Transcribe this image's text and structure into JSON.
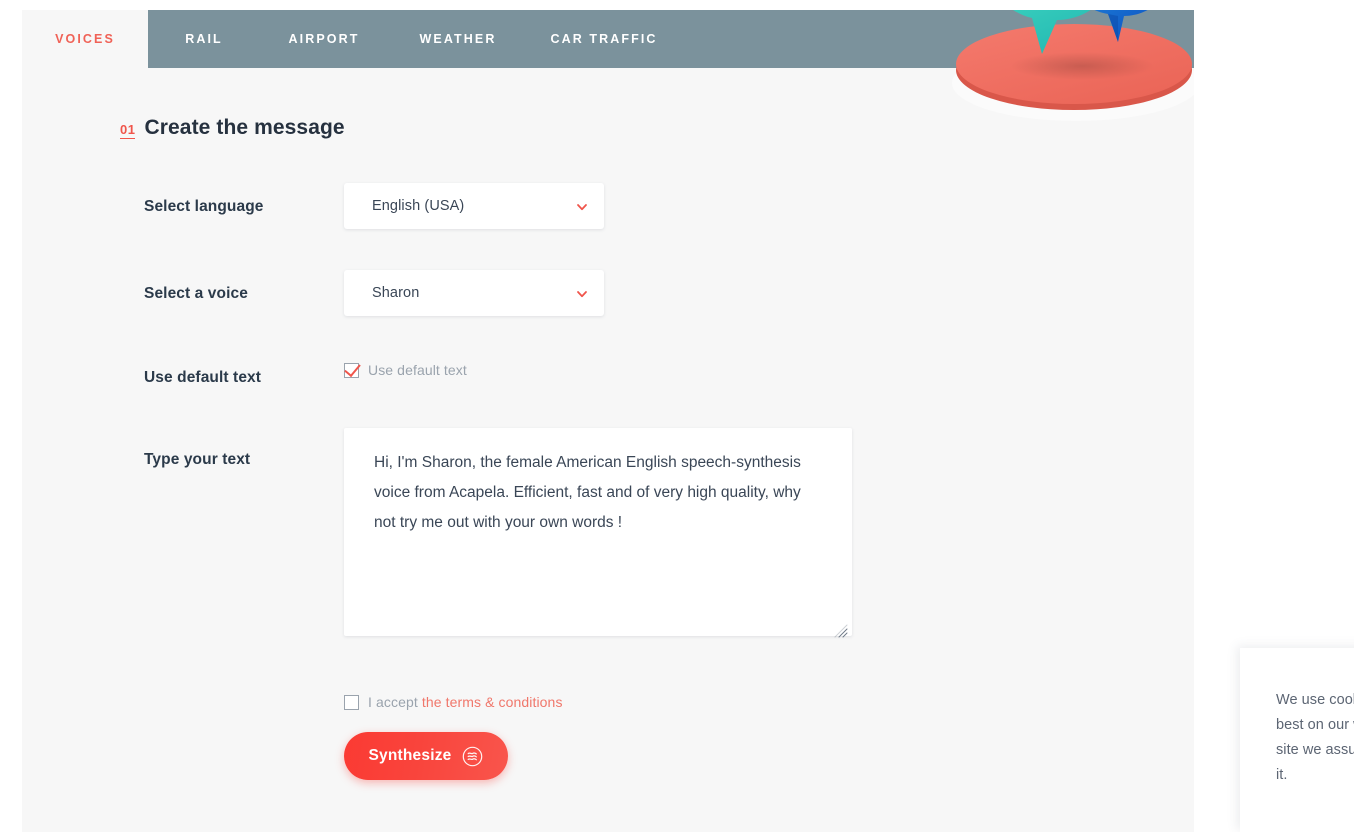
{
  "nav": {
    "tabs": [
      {
        "label": "VOICES",
        "active": true
      },
      {
        "label": "RAIL",
        "active": false
      },
      {
        "label": "AIRPORT",
        "active": false
      },
      {
        "label": "WEATHER",
        "active": false
      },
      {
        "label": "CAR TRAFFIC",
        "active": false
      }
    ]
  },
  "section": {
    "step_number": "01",
    "title": "Create the message"
  },
  "form": {
    "language": {
      "label": "Select language",
      "value": "English (USA)",
      "chevron_icon": "chevron-down-icon"
    },
    "voice": {
      "label": "Select a voice",
      "value": "Sharon",
      "chevron_icon": "chevron-down-icon"
    },
    "default_text": {
      "label": "Use default text",
      "checkbox_label": "Use default text",
      "checked": true
    },
    "message": {
      "label": "Type your text",
      "value": "Hi, I'm Sharon, the female American English speech-synthesis voice from Acapela.  Efficient, fast and of very high quality, why not try me out with your own words !"
    },
    "terms": {
      "checked": false,
      "prefix": "I accept ",
      "link": "the terms & conditions"
    },
    "submit": {
      "label": "Synthesize",
      "icon": "sound-wave-icon"
    }
  },
  "cookie_notice": {
    "text": "We use cookies to give you the best on our website. If you use this site we assume you are happy with it."
  },
  "hero_art": {
    "name": "speech-bubbles-illustration",
    "bubble_text": "♫♪"
  },
  "colors": {
    "accent_red": "#f0554b",
    "button_red": "#f9443c",
    "nav_slate": "#7b929c",
    "page_bg": "#f7f7f7",
    "text_dark": "#2b3a4a",
    "text_muted": "#9aa3ad",
    "coral": "#f06257",
    "bubble_teal": "#3ad3bf",
    "bubble_blue": "#1a6fd4"
  }
}
